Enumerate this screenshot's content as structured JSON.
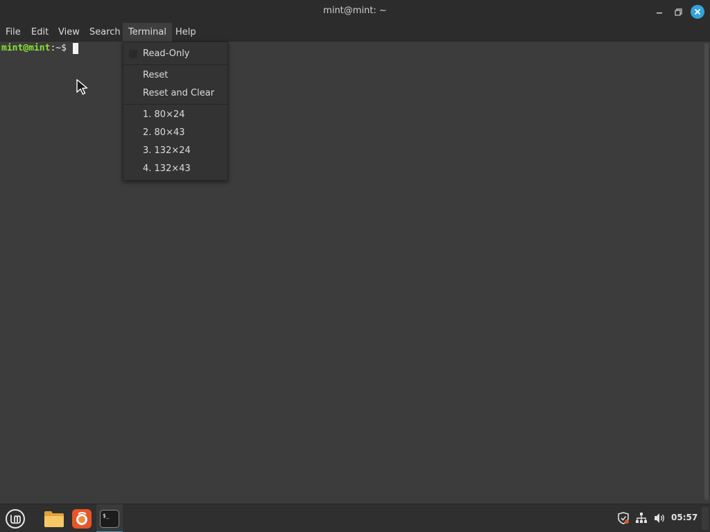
{
  "window": {
    "title": "mint@mint: ~",
    "minimize_icon": "minimize-icon",
    "maximize_icon": "maximize-icon",
    "close_icon": "close-icon"
  },
  "menubar": {
    "items": [
      "File",
      "Edit",
      "View",
      "Search",
      "Terminal",
      "Help"
    ],
    "active": "Terminal"
  },
  "terminal": {
    "prompt_user_host": "mint@mint",
    "prompt_suffix": ":~$ "
  },
  "terminal_menu": {
    "read_only": "Read-Only",
    "reset": "Reset",
    "reset_and_clear": "Reset and Clear",
    "sizes": [
      "1. 80×24",
      "2. 80×43",
      "3. 132×24",
      "4. 132×43"
    ]
  },
  "taskbar": {
    "menu_icon": "linux-mint-logo-icon",
    "apps": [
      "files-folder-icon",
      "firefox-icon",
      "terminal-icon"
    ],
    "active_app": "terminal-icon",
    "tray": [
      "shield-update-icon",
      "network-icon",
      "volume-icon"
    ],
    "clock": "05:57"
  },
  "colors": {
    "accent": "#35a2d8",
    "prompt_green": "#8ae234",
    "background": "#3c3c3c"
  }
}
